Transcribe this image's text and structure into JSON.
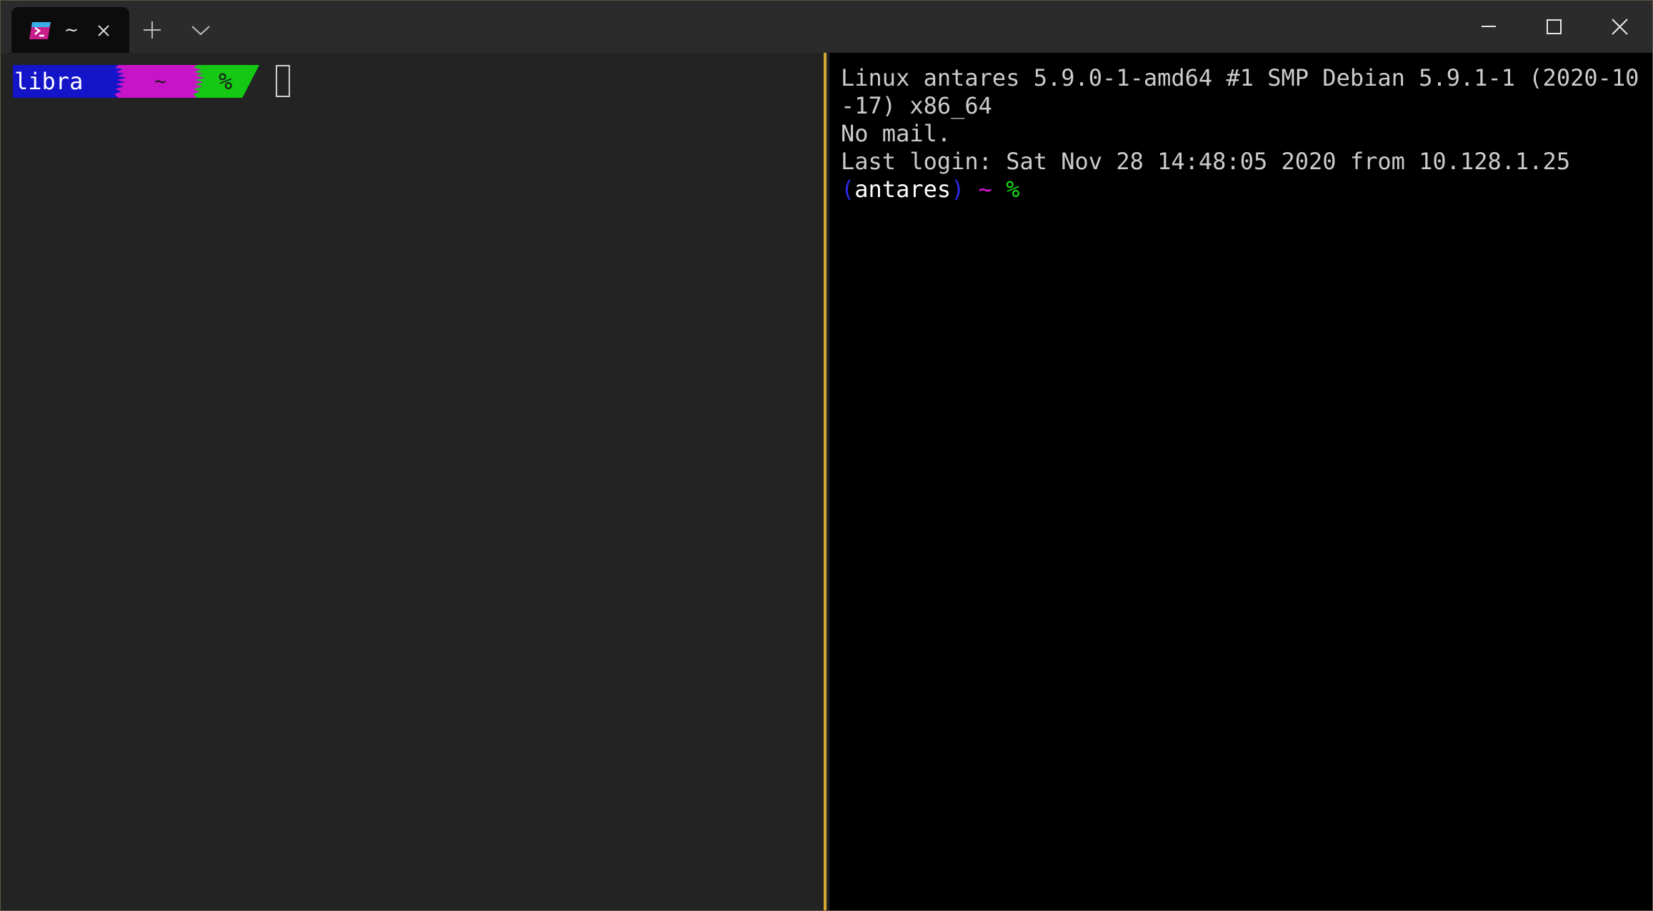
{
  "window": {
    "accent_color": "#d4a833"
  },
  "titlebar": {
    "tab": {
      "icon": "powershell-icon",
      "title": "~",
      "close_icon": "close-icon"
    },
    "new_tab_icon": "plus-icon",
    "dropdown_icon": "chevron-down-icon",
    "caption": {
      "minimize_icon": "minimize-icon",
      "maximize_icon": "maximize-icon",
      "close_icon": "close-icon"
    }
  },
  "left_pane": {
    "background": "#232323",
    "prompt": {
      "user": "libra",
      "dir": "~",
      "symbol": "%",
      "user_color": "#1414c8",
      "dir_color": "#c814c8",
      "symbol_color": "#14c814"
    }
  },
  "right_pane": {
    "background": "#000000",
    "lines": [
      "Linux antares 5.9.0-1-amd64 #1 SMP Debian 5.9.1-1 (2020-10",
      "-17) x86_64",
      "No mail.",
      "Last login: Sat Nov 28 14:48:05 2020 from 10.128.1.25"
    ],
    "prompt": {
      "open_paren": "(",
      "host": "antares",
      "close_paren": ")",
      "dir": "~",
      "symbol": "%"
    }
  }
}
